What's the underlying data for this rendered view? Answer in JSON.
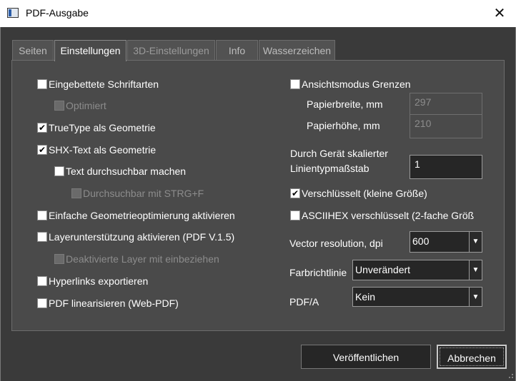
{
  "window": {
    "title": "PDF-Ausgabe",
    "close_glyph": "✕",
    "icon": "app-window-icon"
  },
  "tabs": [
    {
      "label": "Seiten",
      "active": false,
      "enabled": true
    },
    {
      "label": "Einstellungen",
      "active": true,
      "enabled": true
    },
    {
      "label": "3D-Einstellungen",
      "active": false,
      "enabled": false
    },
    {
      "label": "Info",
      "active": false,
      "enabled": true
    },
    {
      "label": "Wasserzeichen",
      "active": false,
      "enabled": true
    }
  ],
  "left_options": [
    {
      "label": "Eingebettete Schriftarten",
      "checked": false,
      "enabled": true
    },
    {
      "label": "Optimiert",
      "checked": false,
      "enabled": false
    },
    {
      "label": "TrueType als Geometrie",
      "checked": true,
      "enabled": true
    },
    {
      "label": "SHX-Text als Geometrie",
      "checked": true,
      "enabled": true
    },
    {
      "label": "Text durchsuchbar machen",
      "checked": false,
      "enabled": true
    },
    {
      "label": "Durchsuchbar mit STRG+F",
      "checked": false,
      "enabled": false
    },
    {
      "label": "Einfache Geometrieoptimierung aktivieren",
      "checked": false,
      "enabled": true
    },
    {
      "label": "Layerunterstützung aktivieren (PDF V.1.5)",
      "checked": false,
      "enabled": true
    },
    {
      "label": "Deaktivierte Layer mit einbeziehen",
      "checked": false,
      "enabled": false
    },
    {
      "label": "Hyperlinks exportieren",
      "checked": false,
      "enabled": true
    },
    {
      "label": "PDF linearisieren (Web-PDF)",
      "checked": false,
      "enabled": true
    }
  ],
  "right": {
    "view_limits": {
      "label": "Ansichtsmodus Grenzen",
      "checked": false
    },
    "paper_width": {
      "label": "Papierbreite, mm",
      "value": "297"
    },
    "paper_height": {
      "label": "Papierhöhe, mm",
      "value": "210"
    },
    "linetype_scale": {
      "label_line1": "Durch Gerät skalierter",
      "label_line2": "Linientypmaßstab",
      "value": "1"
    },
    "encrypted_small": {
      "label": "Verschlüsselt (kleine Größe)",
      "checked": true
    },
    "asciihex": {
      "label": "ASCIIHEX verschlüsselt (2-fache Größ",
      "checked": false
    },
    "vector_resolution": {
      "label": "Vector resolution, dpi",
      "value": "600"
    },
    "color_policy": {
      "label": "Farbrichtlinie",
      "value": "Unverändert"
    },
    "pdfa": {
      "label": "PDF/A",
      "value": "Kein"
    }
  },
  "buttons": {
    "publish": "Veröffentlichen",
    "cancel": "Abbrechen"
  },
  "glyphs": {
    "check": "✔",
    "dropdown": "▼"
  }
}
